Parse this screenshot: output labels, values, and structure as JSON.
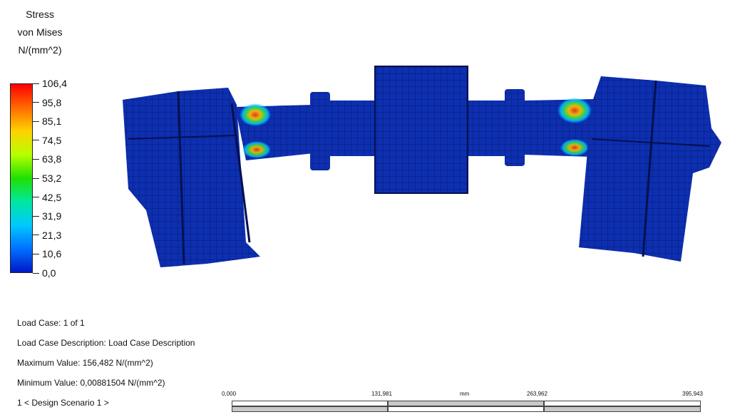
{
  "legend": {
    "title_lines": [
      "Stress",
      "von Mises",
      "N/(mm^2)"
    ],
    "ticks": [
      "106,4",
      "95,8",
      "85,1",
      "74,5",
      "63,8",
      "53,2",
      "42,5",
      "31,9",
      "21,3",
      "10,6",
      "0,0"
    ],
    "colors": [
      "#ff0000",
      "#ff6a00",
      "#ffd200",
      "#b8ff00",
      "#20e000",
      "#00e8a0",
      "#00c8ff",
      "#0070ff",
      "#0018c8"
    ]
  },
  "info": {
    "load_case": "Load Case:  1 of 1",
    "description": "Load Case Description:  Load Case Description",
    "max_value": "Maximum Value:  156,482 N/(mm^2)",
    "min_value": "Minimum Value:  0,00881504 N/(mm^2)",
    "design_scenario": "1 < Design Scenario 1 >"
  },
  "scale": {
    "labels": [
      "0,000",
      "131,981",
      "263,962",
      "395,943"
    ],
    "unit": "mm"
  },
  "model": {
    "body_color": "#0d2fb0",
    "mesh_color": "#061a70",
    "hotspot_colors": [
      "#ff3a00",
      "#ffc800",
      "#40e040",
      "#00c0ff"
    ]
  }
}
